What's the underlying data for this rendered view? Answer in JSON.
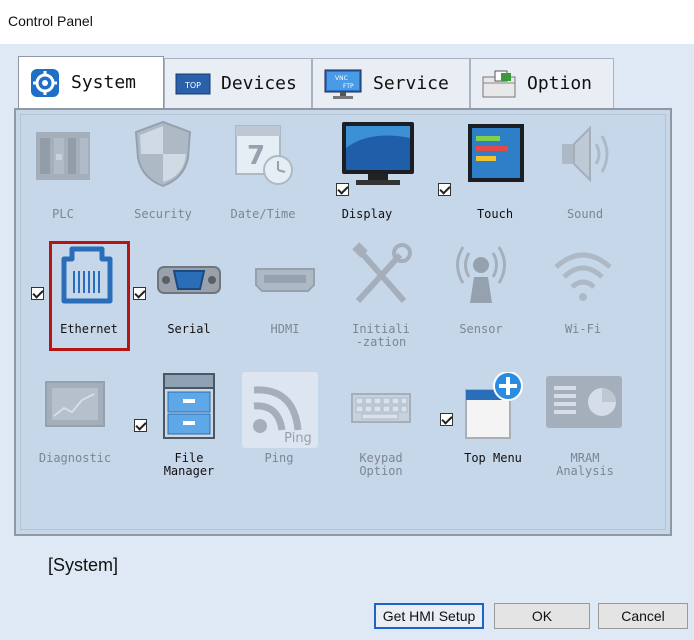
{
  "window": {
    "title": "Control Panel"
  },
  "tabs": [
    {
      "label": "System",
      "icon": "gear-icon",
      "active": true
    },
    {
      "label": "Devices",
      "icon": "tdp-device-icon",
      "active": false
    },
    {
      "label": "Service",
      "icon": "vnc-ftp-service-icon",
      "active": false
    },
    {
      "label": "Option",
      "icon": "option-folder-icon",
      "active": false
    }
  ],
  "grid": {
    "row1": [
      {
        "label": "PLC",
        "icon": "plc-icon",
        "enabled": false,
        "checked": null
      },
      {
        "label": "Security",
        "icon": "shield-icon",
        "enabled": false,
        "checked": null
      },
      {
        "label": "Date/Time",
        "icon": "calendar-clock-icon",
        "enabled": false,
        "checked": null
      },
      {
        "label": "Display",
        "icon": "monitor-icon",
        "enabled": true,
        "checked": true
      },
      {
        "label": "Touch",
        "icon": "touch-screen-icon",
        "enabled": true,
        "checked": true
      },
      {
        "label": "Sound",
        "icon": "speaker-icon",
        "enabled": false,
        "checked": null
      }
    ],
    "row2": [
      {
        "label": "Ethernet",
        "icon": "ethernet-port-icon",
        "enabled": true,
        "checked": true,
        "highlighted": true
      },
      {
        "label": "Serial",
        "icon": "serial-port-icon",
        "enabled": true,
        "checked": true
      },
      {
        "label": "HDMI",
        "icon": "hdmi-port-icon",
        "enabled": false,
        "checked": null
      },
      {
        "label": "Initiali\n-zation",
        "icon": "tools-icon",
        "enabled": false,
        "checked": null
      },
      {
        "label": "Sensor",
        "icon": "sensor-icon",
        "enabled": false,
        "checked": null
      },
      {
        "label": "Wi-Fi",
        "icon": "wifi-icon",
        "enabled": false,
        "checked": null
      }
    ],
    "row3": [
      {
        "label": "Diagnostic",
        "icon": "diagnostic-icon",
        "enabled": false,
        "checked": null
      },
      {
        "label": "File\nManager",
        "icon": "file-cabinet-icon",
        "enabled": true,
        "checked": true
      },
      {
        "label": "Ping",
        "icon": "ping-icon",
        "enabled": false,
        "checked": null,
        "icon_text": "Ping"
      },
      {
        "label": "Keypad\nOption",
        "icon": "keyboard-icon",
        "enabled": false,
        "checked": null
      },
      {
        "label": "Top Menu",
        "icon": "top-menu-add-icon",
        "enabled": true,
        "checked": true
      },
      {
        "label": "MRAM\nAnalysis",
        "icon": "mram-chart-icon",
        "enabled": false,
        "checked": null
      }
    ]
  },
  "status": {
    "text": "[System]"
  },
  "buttons": {
    "get_hmi_setup": "Get HMI Setup",
    "ok": "OK",
    "cancel": "Cancel"
  },
  "colors": {
    "panel_bg": "#c7d7ea",
    "window_bg": "#dfe9f5",
    "highlight_border": "#b51515",
    "focus_border": "#1e64c8"
  }
}
